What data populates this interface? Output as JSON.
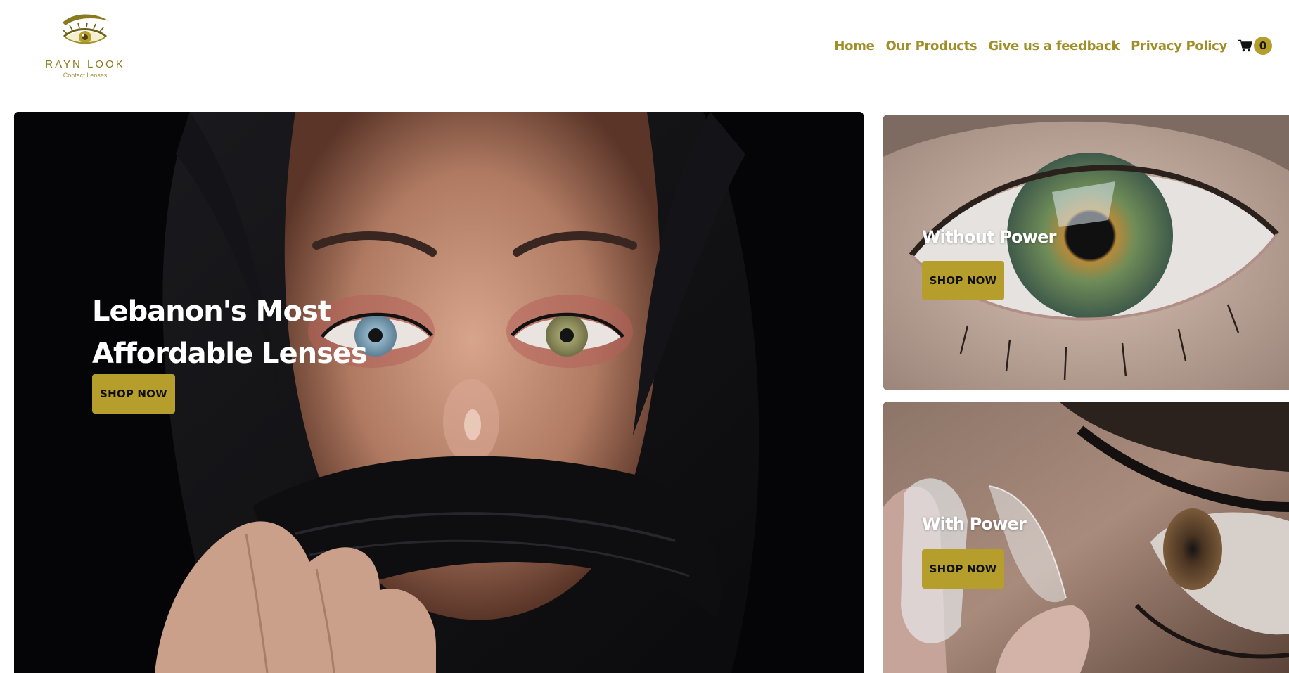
{
  "brand": {
    "name": "RAYN LOOK",
    "tagline": "Contact Lenses"
  },
  "nav": {
    "items": [
      "Home",
      "Our Products",
      "Give us a feedback",
      "Privacy Policy"
    ],
    "cart_count": "0",
    "cart_icon": "shopping-cart-icon"
  },
  "hero": {
    "title": "Lebanon's Most Affordable Lenses",
    "button_label": "SHOP NOW"
  },
  "cards": [
    {
      "title": "Without Power",
      "button_label": "SHOP NOW"
    },
    {
      "title": "With Power",
      "button_label": "SHOP NOW"
    }
  ],
  "colors": {
    "accent": "#b59e2c",
    "nav_text": "#a08f28"
  }
}
